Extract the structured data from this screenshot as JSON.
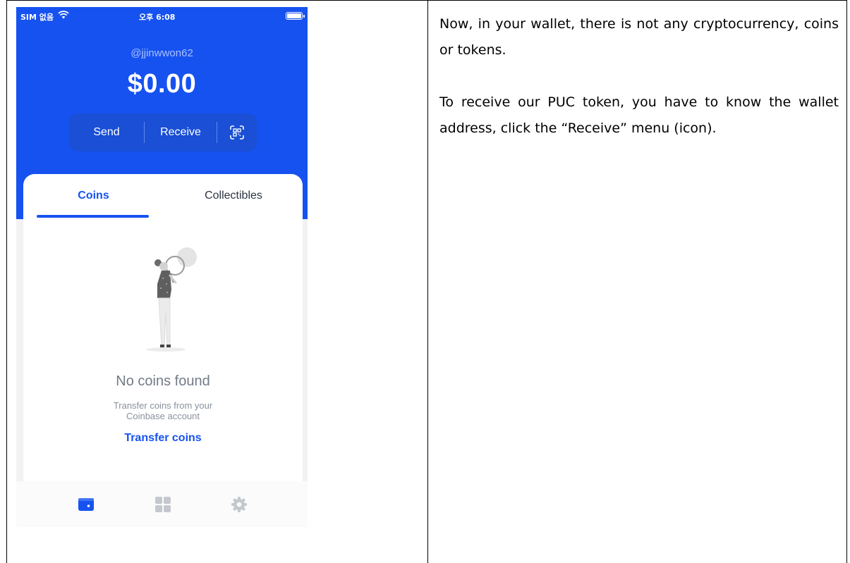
{
  "status_bar": {
    "carrier": "SIM 없음",
    "time": "오후 6:08",
    "battery_level": 1.0
  },
  "wallet": {
    "username": "@jjinwwon62",
    "balance": "$0.00",
    "actions": {
      "send_label": "Send",
      "receive_label": "Receive",
      "scan_icon": "qr-scan-icon"
    },
    "tabs": [
      {
        "label": "Coins",
        "active": true
      },
      {
        "label": "Collectibles",
        "active": false
      }
    ],
    "empty_state": {
      "illustration": "person-with-magnifier-illustration",
      "title": "No coins found",
      "subtitle_line1": "Transfer coins from your",
      "subtitle_line2": "Coinbase account",
      "link_label": "Transfer coins"
    },
    "bottom_nav": [
      {
        "icon": "wallet-icon",
        "active": true
      },
      {
        "icon": "apps-grid-icon",
        "active": false
      },
      {
        "icon": "settings-gear-icon",
        "active": false
      }
    ]
  },
  "colors": {
    "brand_blue": "#1652f0",
    "action_bar": "#1a4fd6",
    "inactive_icon": "#c4c8ce"
  },
  "instructions": {
    "paragraph1": "Now, in your wallet, there is not any cryptocurrency, coins or tokens.",
    "paragraph2": "To receive our PUC token, you have to know the wallet address, click the “Receive” menu (icon)."
  }
}
